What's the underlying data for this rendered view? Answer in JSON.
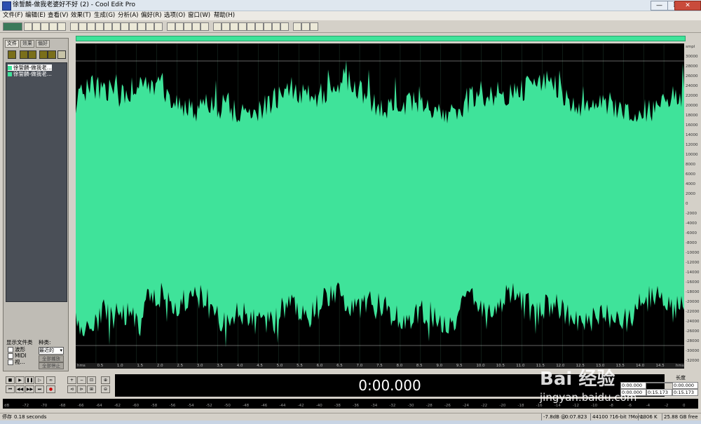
{
  "window": {
    "title": "徐誓麟-做我老婆好不好 (2) - Cool Edit Pro",
    "controls": [
      "—",
      "❐",
      "✕"
    ]
  },
  "menu": [
    "文件(F)",
    "编辑(E)",
    "查看(V)",
    "效果(T)",
    "生成(G)",
    "分析(A)",
    "偏好(R)",
    "选项(O)",
    "窗口(W)",
    "帮助(H)"
  ],
  "organizer": {
    "tabs": [
      "文件",
      "效果",
      "偏好"
    ],
    "files": [
      "徐誓麟-做我老...",
      "徐誓麟-做我老..."
    ],
    "show_types_label": "显示文件类",
    "sort_label": "种类:",
    "types": [
      "波形",
      "MIDI",
      "视..."
    ],
    "sort_value": "最近的",
    "button1": "全部播放",
    "button2": "全部停止"
  },
  "waveform": {
    "color": "#3fe39a",
    "background": "#000000",
    "amplitude_ticks": [
      "smpl",
      "30000",
      "28000",
      "26000",
      "24000",
      "22000",
      "20000",
      "18000",
      "16000",
      "14000",
      "12000",
      "10000",
      "8000",
      "6000",
      "4000",
      "2000",
      "0",
      "-2000",
      "-4000",
      "-6000",
      "-8000",
      "-10000",
      "-12000",
      "-14000",
      "-16000",
      "-18000",
      "-20000",
      "-22000",
      "-24000",
      "-26000",
      "-28000",
      "-30000",
      "-32000"
    ],
    "time_ticks": [
      "hms",
      "0.5",
      "1.0",
      "1.5",
      "2.0",
      "2.5",
      "3.0",
      "3.5",
      "4.0",
      "4.5",
      "5.0",
      "5.5",
      "6.0",
      "6.5",
      "7.0",
      "7.5",
      "8.0",
      "8.5",
      "9.0",
      "9.5",
      "10.0",
      "10.5",
      "11.0",
      "11.5",
      "12.0",
      "12.5",
      "13.0",
      "13.5",
      "14.0",
      "14.5",
      "hms"
    ]
  },
  "transport": {
    "time": "0:00.000",
    "begin_label": "开始",
    "end_label": "结束",
    "length_label": "长度",
    "sel_label": "选",
    "view_label": "查看",
    "sel_begin": "0:00.000",
    "sel_end": "",
    "sel_length": "0:00.000",
    "view_begin": "0:00.000",
    "view_end": "0:15.173",
    "view_length": "0:15.173"
  },
  "meter_ticks": [
    "dB",
    "-72",
    "-70",
    "-68",
    "-66",
    "-64",
    "-62",
    "-60",
    "-58",
    "-56",
    "-54",
    "-52",
    "-50",
    "-48",
    "-46",
    "-44",
    "-42",
    "-40",
    "-38",
    "-36",
    "-34",
    "-32",
    "-30",
    "-28",
    "-26",
    "-24",
    "-22",
    "-20",
    "-18",
    "-16",
    "-14",
    "-12",
    "-10",
    "-8",
    "-6",
    "-4",
    "-2",
    "0"
  ],
  "status": {
    "left_label": "停存",
    "left_value": "0.18 seconds",
    "level": "-7.8dB @",
    "pos": "0:07.823",
    "format": "44100 ?16-bit ?Mono",
    "size": "1306 K",
    "free": "25.88 GB free"
  },
  "watermark": {
    "line1": "Bai 经验",
    "line2": "jingyan.baidu.com"
  }
}
